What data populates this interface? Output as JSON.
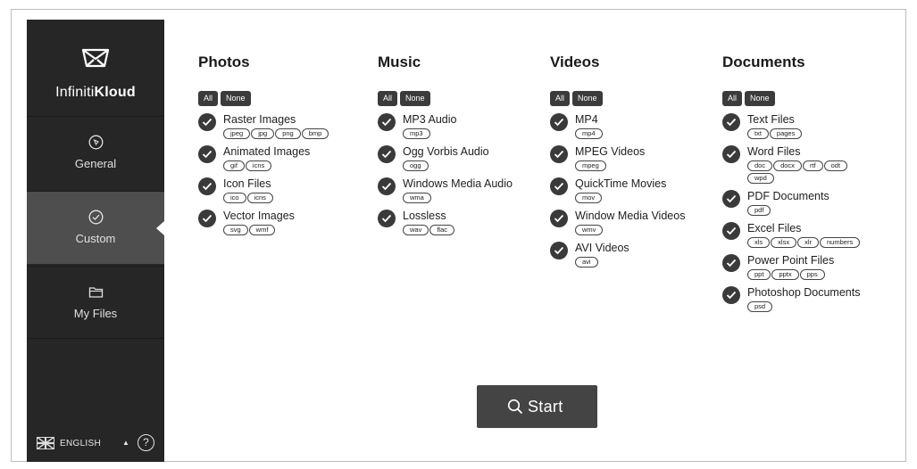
{
  "app": {
    "brand_light": "Infiniti",
    "brand_bold": "Kloud"
  },
  "sidebar": {
    "items": [
      {
        "label": "General",
        "icon": "compass-icon"
      },
      {
        "label": "Custom",
        "icon": "check-circle-icon"
      },
      {
        "label": "My Files",
        "icon": "folder-icon"
      }
    ],
    "language": "ENGLISH",
    "help": "?"
  },
  "buttons": {
    "all": "All",
    "none": "None",
    "start": "Start"
  },
  "columns": [
    {
      "title": "Photos",
      "items": [
        {
          "label": "Raster Images",
          "exts": [
            "jpeg",
            "jpg",
            "png",
            "bmp"
          ]
        },
        {
          "label": "Animated Images",
          "exts": [
            "gif",
            "icns"
          ]
        },
        {
          "label": "Icon Files",
          "exts": [
            "ico",
            "icns"
          ]
        },
        {
          "label": "Vector Images",
          "exts": [
            "svg",
            "wmf"
          ]
        }
      ]
    },
    {
      "title": "Music",
      "items": [
        {
          "label": "MP3 Audio",
          "exts": [
            "mp3"
          ]
        },
        {
          "label": "Ogg Vorbis Audio",
          "exts": [
            "ogg"
          ]
        },
        {
          "label": "Windows Media Audio",
          "exts": [
            "wma"
          ]
        },
        {
          "label": "Lossless",
          "exts": [
            "wav",
            "flac"
          ]
        }
      ]
    },
    {
      "title": "Videos",
      "items": [
        {
          "label": "MP4",
          "exts": [
            "mp4"
          ]
        },
        {
          "label": "MPEG Videos",
          "exts": [
            "mpeg"
          ]
        },
        {
          "label": "QuickTime Movies",
          "exts": [
            "mov"
          ]
        },
        {
          "label": "Window Media Videos",
          "exts": [
            "wmv"
          ]
        },
        {
          "label": "AVI Videos",
          "exts": [
            "avi"
          ]
        }
      ]
    },
    {
      "title": "Documents",
      "items": [
        {
          "label": "Text Files",
          "exts": [
            "txt",
            "pages"
          ]
        },
        {
          "label": "Word Files",
          "exts": [
            "doc",
            "docx",
            "rtf",
            "odt",
            "wpd"
          ]
        },
        {
          "label": "PDF Documents",
          "exts": [
            "pdf"
          ]
        },
        {
          "label": "Excel Files",
          "exts": [
            "xls",
            "xlsx",
            "xlr",
            "numbers"
          ]
        },
        {
          "label": "Power Point Files",
          "exts": [
            "ppt",
            "pptx",
            "pps"
          ]
        },
        {
          "label": "Photoshop Documents",
          "exts": [
            "psd"
          ]
        }
      ]
    }
  ],
  "colors": {
    "sidebar": "#262626",
    "sidebar_active": "#4e4e4e",
    "accent": "#3a3a3a",
    "start_button": "#444444"
  }
}
